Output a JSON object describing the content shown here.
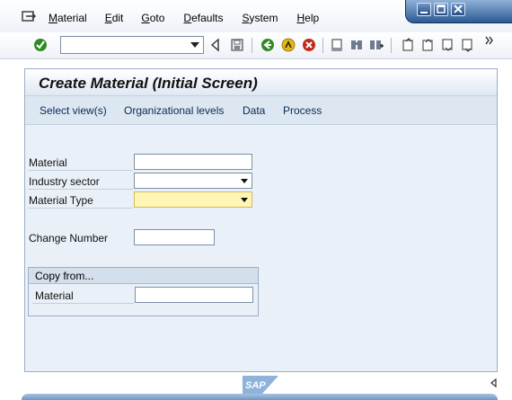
{
  "menu": {
    "items": [
      {
        "label": "Material",
        "acc": "M",
        "rest": "aterial"
      },
      {
        "label": "Edit",
        "acc": "E",
        "rest": "dit"
      },
      {
        "label": "Goto",
        "acc": "G",
        "rest": "oto"
      },
      {
        "label": "Defaults",
        "acc": "D",
        "rest": "efaults"
      },
      {
        "label": "System",
        "acc": "S",
        "rest": "ystem"
      },
      {
        "label": "Help",
        "acc": "H",
        "rest": "elp"
      }
    ]
  },
  "toolbar": {
    "command_field_value": "",
    "icons": [
      "enter-icon",
      "back-icon",
      "save-icon",
      "back-nav-icon",
      "exit-icon",
      "cancel-icon",
      "print-icon",
      "find-icon",
      "find-next-icon",
      "first-page-icon",
      "previous-page-icon",
      "next-page-icon",
      "last-page-icon",
      "more-icon"
    ]
  },
  "screen": {
    "title": "Create Material (Initial Screen)",
    "app_toolbar": [
      "Select view(s)",
      "Organizational levels",
      "Data",
      "Process"
    ]
  },
  "form": {
    "material_label": "Material",
    "material_value": "",
    "industry_sector_label": "Industry sector",
    "industry_sector_value": "",
    "material_type_label": "Material Type",
    "material_type_value": "",
    "change_number_label": "Change Number",
    "change_number_value": ""
  },
  "copy_from": {
    "title": "Copy from...",
    "material_label": "Material",
    "material_value": ""
  },
  "footer": {
    "logo_text": "SAP"
  },
  "colors": {
    "panel_bg": "#eaf0f8",
    "required_field": "#fff6b3",
    "window_control": "#2c5a94"
  }
}
